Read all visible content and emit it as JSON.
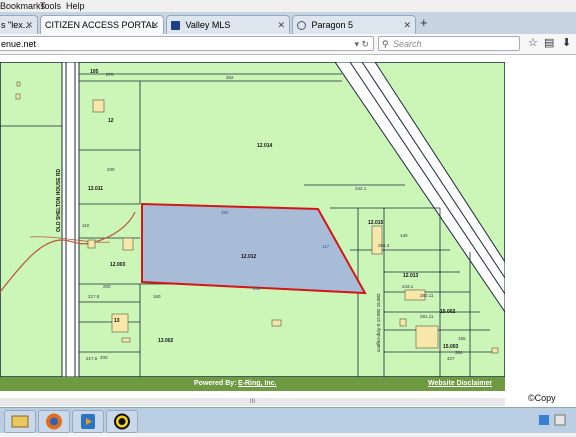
{
  "menu": {
    "bookmarks": "Bookmarks",
    "tools": "Tools",
    "help": "Help"
  },
  "tabs": [
    {
      "label": "s \"lex...",
      "active": false
    },
    {
      "label": "CITIZEN ACCESS PORTAL",
      "active": true
    },
    {
      "label": "Valley MLS",
      "active": false
    },
    {
      "label": "Paragon 5",
      "active": false
    }
  ],
  "address": {
    "value": "enue.net"
  },
  "search": {
    "placeholder": "Search"
  },
  "map": {
    "labels": {
      "p105": "105",
      "p12": "12",
      "p12014": "12.014",
      "p12011": "12.011",
      "p12012": "12.012",
      "p12003": "12.003",
      "p12015": "12.015",
      "p12013": "12.013",
      "p13": "13",
      "p13002": "13.002",
      "p15002": "15.002",
      "p15003": "15.003",
      "road_old": "OLD SHELTON HOUSE RD",
      "road_conflict": "conflict-duty-S 12.002 15.002",
      "d380": "380",
      "d260": "260",
      "d117": "117",
      "d200": "200",
      "d160": "160",
      "d342": "342.1",
      "d243": "243.1",
      "d2178": "217.8",
      "d2176": "217.6",
      "d270": "270",
      "d262": "262",
      "d200b": "200",
      "d200c": "200",
      "d2901": "290.11",
      "d2911": "291.11",
      "d364": "364",
      "d427": "427",
      "d155": "155",
      "d110": "110",
      "d140": "140",
      "d2863": "286.3"
    },
    "colors": {
      "parcel": "#ccf5b8",
      "selected": "#a8bcd8",
      "selected_border": "#d01818",
      "lines": "#1a2a3a"
    }
  },
  "footer": {
    "powered_by": "Powered By:",
    "ering": "E-Ring, Inc.",
    "disclaimer": "Website Disclaimer"
  },
  "copyright": "©Copy",
  "scroll_marker": "III",
  "taskbar": {
    "apps": [
      "file-explorer-icon",
      "firefox-icon",
      "media-player-icon",
      "circle-app-icon"
    ]
  }
}
